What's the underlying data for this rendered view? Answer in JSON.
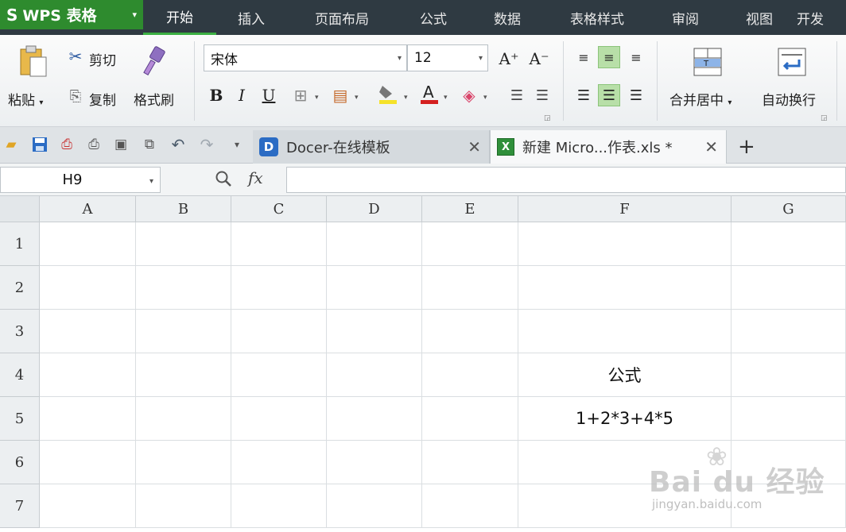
{
  "app": {
    "logo_mark": "S",
    "logo_text": "WPS 表格",
    "logo_caret": "▾"
  },
  "menu": {
    "tabs": [
      {
        "label": "开始",
        "active": true
      },
      {
        "label": "插入",
        "active": false
      },
      {
        "label": "页面布局",
        "active": false
      },
      {
        "label": "公式",
        "active": false
      },
      {
        "label": "数据",
        "active": false
      },
      {
        "label": "表格样式",
        "active": false
      },
      {
        "label": "审阅",
        "active": false
      },
      {
        "label": "视图",
        "active": false
      },
      {
        "label": "开发",
        "active": false
      }
    ]
  },
  "ribbon": {
    "paste_label": "粘贴",
    "cut_label": "剪切",
    "copy_label": "复制",
    "format_painter_label": "格式刷",
    "font_name": "宋体",
    "font_size": "12",
    "bold": "B",
    "italic": "I",
    "underline": "U",
    "increase_font": "A⁺",
    "decrease_font": "A⁻",
    "merge_center_label": "合并居中",
    "wrap_text_label": "自动换行",
    "dropdown_glyph": "▾"
  },
  "doc_tabs": [
    {
      "label": "Docer-在线模板",
      "logo": "D",
      "active": false,
      "close": "✕"
    },
    {
      "label": "新建 Micro...作表.xls *",
      "logo": "X",
      "active": true,
      "close": "✕"
    }
  ],
  "add_tab": "+",
  "formula_bar": {
    "name_box": "H9",
    "fx": "fx",
    "formula": ""
  },
  "sheet": {
    "columns": [
      "A",
      "B",
      "C",
      "D",
      "E",
      "F",
      "G"
    ],
    "rows": [
      "1",
      "2",
      "3",
      "4",
      "5",
      "6",
      "7"
    ],
    "cells": {
      "F4": "公式",
      "F5": "1+2*3+4*5"
    }
  },
  "watermark": {
    "main": "Bai du 经验",
    "sub": "jingyan.baidu.com"
  },
  "colors": {
    "menubar_bg": "#2f3a42",
    "logo_green": "#2e8b2e",
    "accent_green": "#3cb043",
    "align_active": "#b8dfa8"
  }
}
